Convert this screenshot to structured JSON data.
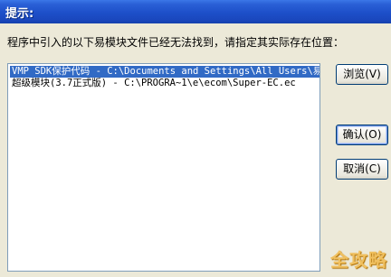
{
  "window": {
    "title": "提示:"
  },
  "message": "程序中引入的以下易模块文件已经无法找到，请指定其实际存在位置：",
  "list": {
    "items": [
      "VMP SDK保护代码 - C:\\Documents and Settings\\All Users\\易语",
      "超级模块(3.7正式版) - C:\\PROGRA~1\\e\\ecom\\Super-EC.ec"
    ],
    "selected_index": 0
  },
  "buttons": {
    "browse": "浏览(V)",
    "confirm": "确认(O)",
    "cancel": "取消(C)"
  },
  "watermark": "全攻略",
  "colors": {
    "titlebar": "#1d4fc9",
    "selection": "#316ac5",
    "dialog_bg": "#ece9d8"
  }
}
